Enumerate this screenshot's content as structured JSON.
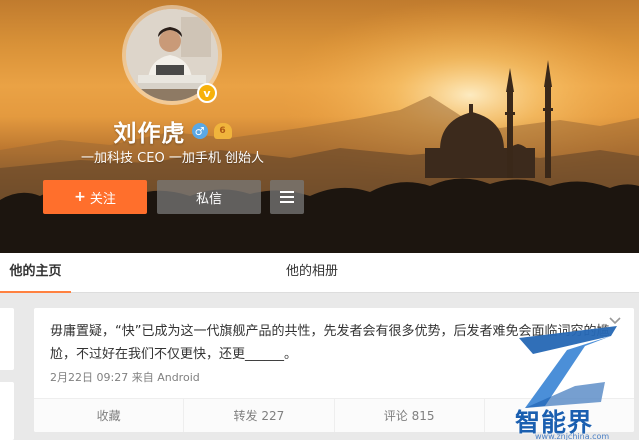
{
  "profile": {
    "name": "刘作虎",
    "bio": "一加科技 CEO 一加手机 创始人",
    "verified_mark": "v",
    "gender_icon": "male-icon",
    "level_icon": "vip-badge-icon",
    "level_label": "6"
  },
  "actions": {
    "follow_label": "关注",
    "follow_icon": "+",
    "message_label": "私信",
    "more_icon": "menu-icon"
  },
  "tabs": [
    {
      "label": "他的主页",
      "active": true
    },
    {
      "label": "他的相册",
      "active": false
    }
  ],
  "post": {
    "text": "毋庸置疑，“快”已成为这一代旗舰产品的共性，先发者会有很多优势，后发者难免会面临词穷的尴尬，不过好在我们不仅更快，还更______。",
    "time": "2月22日 09:27",
    "source": "来自 Android",
    "actions": [
      {
        "label": "收藏"
      },
      {
        "label": "转发 227"
      },
      {
        "label": "评论 815"
      },
      {
        "label": ""
      }
    ]
  },
  "watermark": {
    "logo_text": "智能界",
    "url": "www.znjchina.com"
  },
  "colors": {
    "accent": "#ff6f2c",
    "tab_indicator": "#ff8140",
    "watermark_blue": "#1a5fb0"
  }
}
